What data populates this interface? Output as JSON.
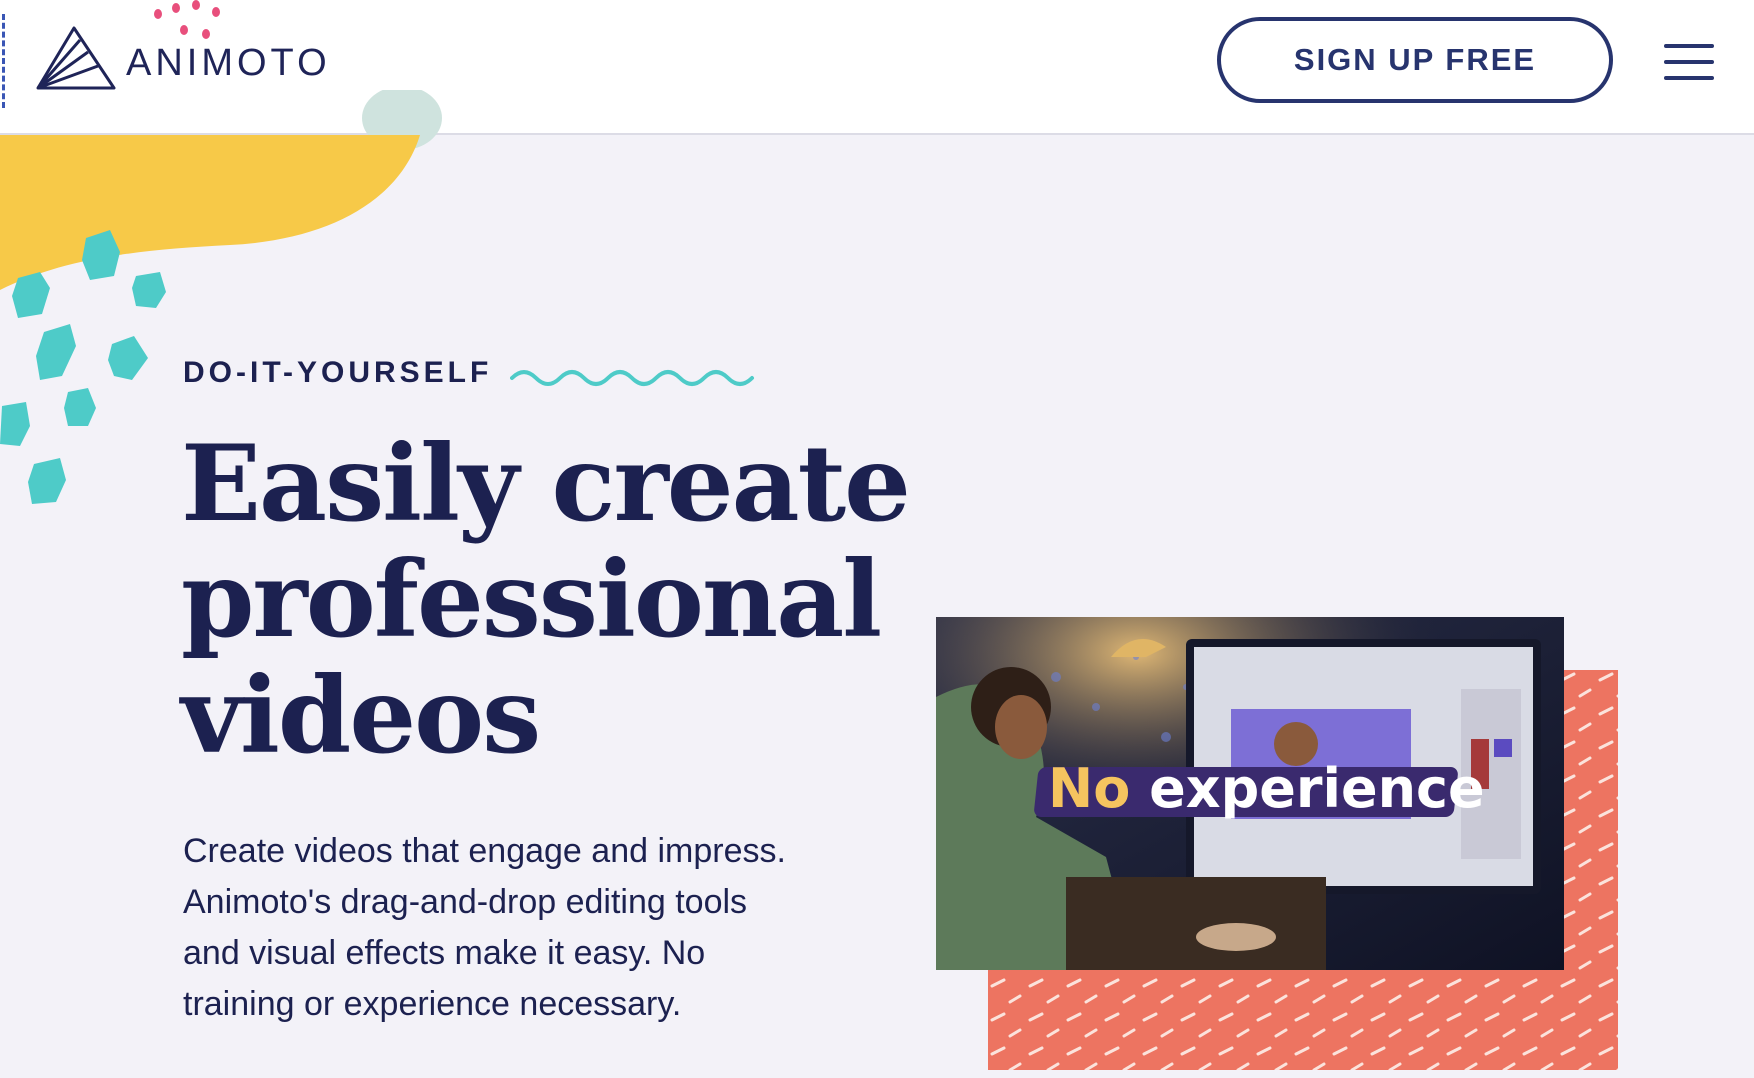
{
  "header": {
    "logo_text": "ANIMOTO",
    "signup_label": "SIGN UP FREE",
    "menu_icon": "hamburger-menu-icon"
  },
  "hero": {
    "eyebrow": "DO-IT-YOURSELF",
    "headline_lines": [
      "Easily create",
      "professional",
      "videos"
    ],
    "body_lines": [
      "Create videos that engage and impress.",
      "Animoto's drag-and-drop editing tools",
      "and visual effects make it easy. No",
      "training or experience necessary."
    ]
  },
  "video": {
    "caption_word1": "No",
    "caption_word2": "experience"
  },
  "colors": {
    "navy": "#1c2150",
    "button_navy": "#27346e",
    "page_bg": "#f3f2f8",
    "yellow": "#f7c948",
    "teal": "#4ecbc8",
    "coral": "#ed7461",
    "pink": "#e84f7c"
  }
}
